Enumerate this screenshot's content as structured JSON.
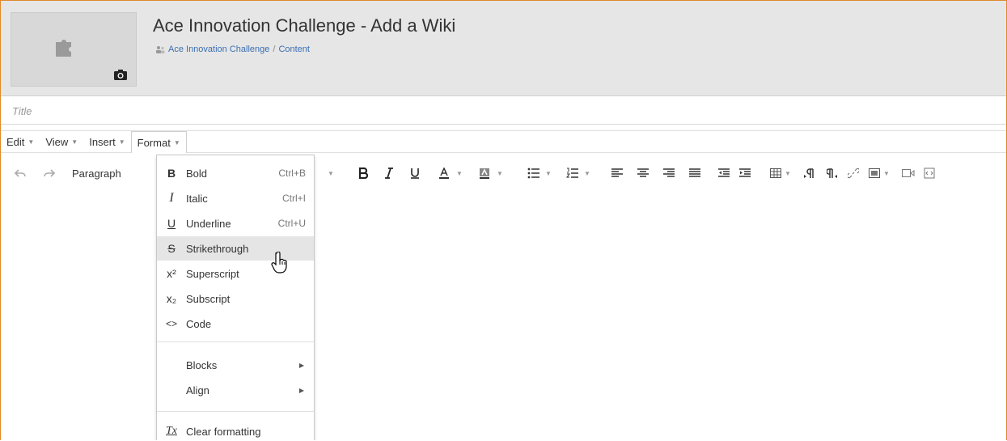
{
  "header": {
    "title": "Ace Innovation Challenge - Add a Wiki",
    "breadcrumb": {
      "group": "Ace Innovation Challenge",
      "separator": "/",
      "section": "Content"
    }
  },
  "title_field": {
    "placeholder": "Title"
  },
  "menubar": {
    "edit": "Edit",
    "view": "View",
    "insert": "Insert",
    "format": "Format"
  },
  "toolbar": {
    "block_format": "Paragraph"
  },
  "format_menu": {
    "items": [
      {
        "icon": "B",
        "label": "Bold",
        "shortcut": "Ctrl+B"
      },
      {
        "icon": "I",
        "label": "Italic",
        "shortcut": "Ctrl+I"
      },
      {
        "icon": "U",
        "label": "Underline",
        "shortcut": "Ctrl+U"
      },
      {
        "icon": "S",
        "label": "Strikethrough",
        "shortcut": ""
      },
      {
        "icon": "x²",
        "label": "Superscript",
        "shortcut": ""
      },
      {
        "icon": "x₂",
        "label": "Subscript",
        "shortcut": ""
      },
      {
        "icon": "<>",
        "label": "Code",
        "shortcut": ""
      },
      {
        "label": "Blocks"
      },
      {
        "label": "Align"
      },
      {
        "icon": "Tx",
        "label": "Clear formatting"
      }
    ],
    "hovered": "Strikethrough"
  },
  "colors": {
    "accent_border": "#e08a2a",
    "link": "#3a6fb3",
    "header_bg": "#e6e6e6"
  }
}
